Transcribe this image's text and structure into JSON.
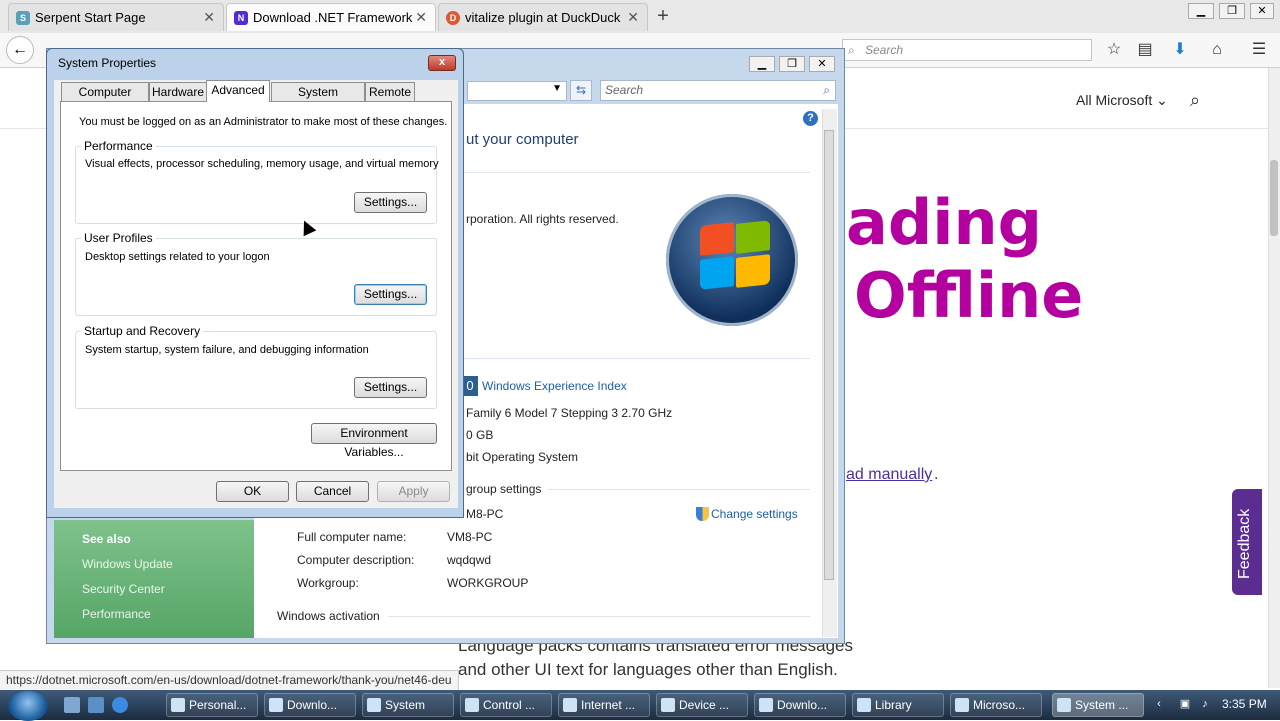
{
  "browser": {
    "tabs": [
      {
        "title": "Serpent Start Page",
        "icon": "serpent-icon",
        "active": false
      },
      {
        "title": "Download .NET Framework",
        "icon": "dotnet-icon",
        "active": true
      },
      {
        "title": "vitalize plugin at DuckDuck",
        "icon": "duckduckgo-icon",
        "active": false
      }
    ],
    "new_tab_label": "+",
    "search_placeholder": "Search",
    "status_url": "https://dotnet.microsoft.com/en-us/download/dotnet-framework/thank-you/net46-deu"
  },
  "webpage": {
    "all_microsoft": "All Microsoft",
    "heading_line1": "ading",
    "heading_line2": "Offline",
    "download_manually_link": "ad manually",
    "period": ".",
    "language_text": "Language packs contains translated error messages and other UI text for languages other than English.",
    "feedback_label": "Feedback",
    "accent_color": "#b4009e"
  },
  "system_window": {
    "search_placeholder": "Search",
    "heading_fragment": "ut your computer",
    "copyright_fragment": "rporation.  All rights reserved.",
    "experience_index_badge": "0",
    "experience_index_link": "Windows Experience Index",
    "processor_fragment": "Family 6 Model 7 Stepping 3   2.70 GHz",
    "memory_fragment": "0 GB",
    "system_type_fragment": "bit Operating System",
    "group_settings_header": "group settings",
    "change_settings": "Change settings",
    "computer_name_value": "M8-PC",
    "full_name_label": "Full computer name:",
    "full_name_value": "VM8-PC",
    "description_label": "Computer description:",
    "description_value": "wqdqwd",
    "workgroup_label": "Workgroup:",
    "workgroup_value": "WORKGROUP",
    "activation_header": "Windows activation",
    "see_also": {
      "heading": "See also",
      "items": [
        "Windows Update",
        "Security Center",
        "Performance"
      ]
    }
  },
  "dialog": {
    "title": "System Properties",
    "close_label": "x",
    "tabs": [
      "Computer Name",
      "Hardware",
      "Advanced",
      "System Protection",
      "Remote"
    ],
    "active_tab": "Advanced",
    "admin_note": "You must be logged on as an Administrator to make most of these changes.",
    "groups": [
      {
        "title": "Performance",
        "desc": "Visual effects, processor scheduling, memory usage, and virtual memory",
        "button": "Settings..."
      },
      {
        "title": "User Profiles",
        "desc": "Desktop settings related to your logon",
        "button": "Settings..."
      },
      {
        "title": "Startup and Recovery",
        "desc": "System startup, system failure, and debugging information",
        "button": "Settings..."
      }
    ],
    "env_button": "Environment Variables...",
    "ok": "OK",
    "cancel": "Cancel",
    "apply": "Apply"
  },
  "taskbar": {
    "items": [
      "Personal...",
      "Downlo...",
      "System",
      "Control ...",
      "Internet ...",
      "Device ...",
      "Downlo...",
      "Library",
      "Microso...",
      "System ..."
    ],
    "active_index": 9,
    "clock": "3:35 PM"
  }
}
